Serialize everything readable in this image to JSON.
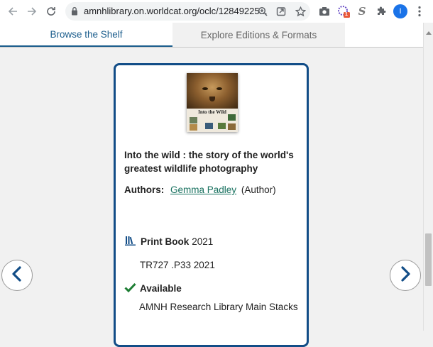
{
  "browser": {
    "url": "amnhlibrary.on.worldcat.org/oclc/12849225...",
    "profile_initial": "I",
    "extension_badge": "1",
    "icons": [
      "back-arrow-icon",
      "forward-arrow-icon",
      "reload-icon",
      "lock-icon",
      "zoom-icon",
      "share-icon",
      "star-icon",
      "camera-icon",
      "extension-icon",
      "s-extension-icon",
      "puzzle-icon",
      "kebab-menu-icon"
    ]
  },
  "tabs": {
    "shelf": "Browse the Shelf",
    "editions": "Explore Editions & Formats"
  },
  "item": {
    "cover_title": "Into the Wild",
    "title": "Into the wild : the story of the world's greatest wildlife photography",
    "authors_label": "Authors:",
    "author_name": "Gemma Padley",
    "author_role": "(Author)",
    "format_name": "Print Book",
    "format_year": "2021",
    "call_number": "TR727 .P33 2021",
    "availability": "Available",
    "location": "AMNH Research Library Main Stacks"
  },
  "colors": {
    "accent": "#124d87",
    "tab_active": "#1b5d8c",
    "link": "#18715f",
    "available_check": "#1e7e34"
  }
}
